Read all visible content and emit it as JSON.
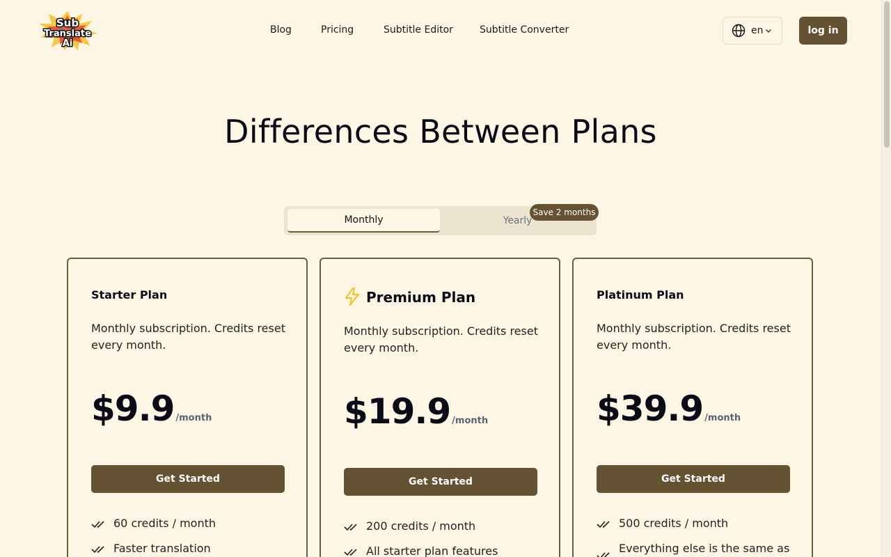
{
  "logo": {
    "alt": "SubTranslate Ai",
    "lines": [
      "Sub",
      "Translate",
      "Ai"
    ]
  },
  "nav": {
    "items": [
      {
        "label": "Blog"
      },
      {
        "label": "Pricing"
      },
      {
        "label": "Subtitle Editor"
      },
      {
        "label": "Subtitle Converter"
      }
    ],
    "language": "en",
    "language_icon": "globe-icon",
    "login_label": "log in"
  },
  "page": {
    "title": "Differences Between Plans"
  },
  "billing_toggle": {
    "monthly_label": "Monthly",
    "yearly_label": "Yearly",
    "selected": "Monthly",
    "save_badge": "Save 2 months"
  },
  "plans": [
    {
      "name": "Starter Plan",
      "description": "Monthly subscription. Credits reset every month.",
      "price": "$9.9",
      "period": "/month",
      "cta": "Get Started",
      "features": [
        "60 credits / month",
        "Faster translation"
      ]
    },
    {
      "name": "Premium Plan",
      "icon": "lightning-bolt-icon",
      "description": "Monthly subscription. Credits reset every month.",
      "price": "$19.9",
      "period": "/month",
      "cta": "Get Started",
      "features": [
        "200 credits / month",
        "All starter plan features"
      ]
    },
    {
      "name": "Platinum Plan",
      "description": "Monthly subscription. Credits reset every month.",
      "price": "$39.9",
      "period": "/month",
      "cta": "Get Started",
      "features": [
        "500 credits / month",
        "Everything else is the same as"
      ]
    }
  ],
  "colors": {
    "background": "#fdf6e4",
    "accent": "#655232",
    "bolt": "#f2c21b",
    "text": "#0b0b18"
  }
}
